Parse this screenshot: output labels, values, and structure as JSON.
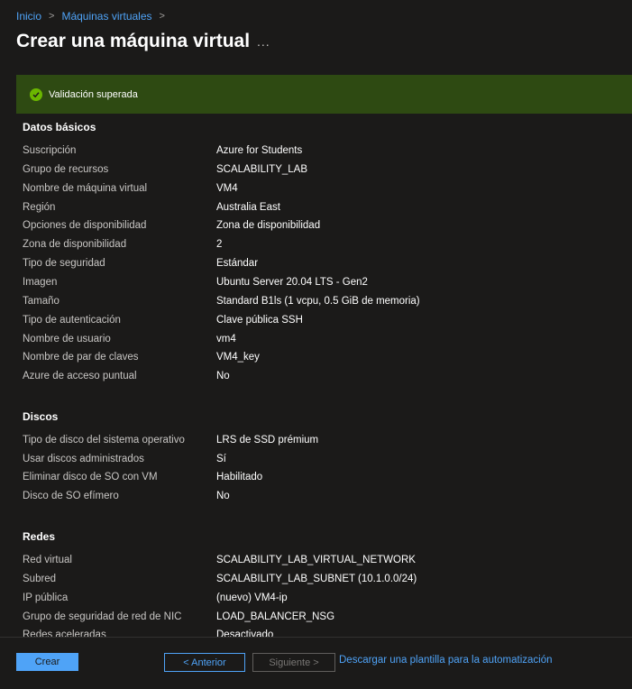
{
  "breadcrumb": {
    "items": [
      "Inicio",
      "Máquinas virtuales"
    ],
    "separator": ">"
  },
  "page": {
    "title": "Crear una máquina virtual",
    "more": "..."
  },
  "validation": {
    "text": "Validación superada",
    "color": "#6bb700"
  },
  "sections": {
    "basics": {
      "title": "Datos básicos",
      "rows": [
        {
          "label": "Suscripción",
          "value": "Azure for Students"
        },
        {
          "label": "Grupo de recursos",
          "value": "SCALABILITY_LAB"
        },
        {
          "label": "Nombre de máquina virtual",
          "value": "VM4"
        },
        {
          "label": "Región",
          "value": "Australia East"
        },
        {
          "label": "Opciones de disponibilidad",
          "value": "Zona de disponibilidad"
        },
        {
          "label": "Zona de disponibilidad",
          "value": "2"
        },
        {
          "label": "Tipo de seguridad",
          "value": "Estándar"
        },
        {
          "label": "Imagen",
          "value": "Ubuntu Server 20.04 LTS - Gen2"
        },
        {
          "label": "Tamaño",
          "value": "Standard B1ls (1 vcpu, 0.5 GiB de memoria)"
        },
        {
          "label": "Tipo de autenticación",
          "value": "Clave pública SSH"
        },
        {
          "label": "Nombre de usuario",
          "value": "vm4"
        },
        {
          "label": "Nombre de par de claves",
          "value": "VM4_key"
        },
        {
          "label": "Azure de acceso puntual",
          "value": "No"
        }
      ]
    },
    "disks": {
      "title": "Discos",
      "rows": [
        {
          "label": "Tipo de disco del sistema operativo",
          "value": "LRS de SSD prémium"
        },
        {
          "label": "Usar discos administrados",
          "value": "Sí"
        },
        {
          "label": "Eliminar disco de SO con VM",
          "value": "Habilitado"
        },
        {
          "label": "Disco de SO efímero",
          "value": "No"
        }
      ]
    },
    "networking": {
      "title": "Redes",
      "rows": [
        {
          "label": "Red virtual",
          "value": "SCALABILITY_LAB_VIRTUAL_NETWORK"
        },
        {
          "label": "Subred",
          "value": "SCALABILITY_LAB_SUBNET (10.1.0.0/24)"
        },
        {
          "label": "IP pública",
          "value": "(nuevo) VM4-ip"
        },
        {
          "label": "Grupo de seguridad de red de NIC",
          "value": "LOAD_BALANCER_NSG"
        },
        {
          "label": "Redes aceleradas",
          "value": "Desactivado"
        }
      ]
    }
  },
  "footer": {
    "create_label": "Crear",
    "prev_label": "< Anterior",
    "next_label": "Siguiente >",
    "download_label": "Descargar una plantilla para la automatización"
  },
  "icons": {
    "validation": "checkmark-circle-icon",
    "more": "ellipsis-icon",
    "breadcrumb_separator": "chevron-right-icon"
  }
}
